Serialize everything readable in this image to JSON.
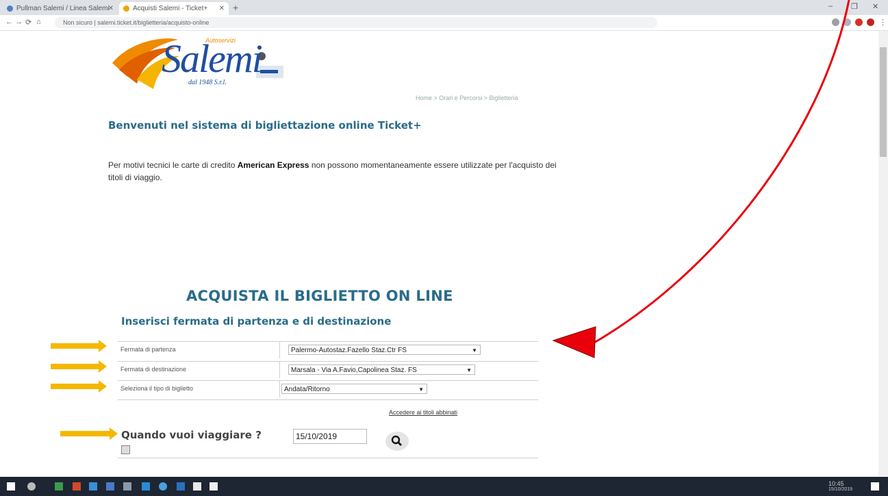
{
  "browser": {
    "tabs": [
      {
        "label": "Pullman Salemi / Linea Salemi",
        "active": false
      },
      {
        "label": "Acquisti Salemi - Ticket+",
        "active": true
      }
    ],
    "new_tab_glyph": "+",
    "window_controls": [
      "–",
      "❐",
      "✕"
    ],
    "nav": {
      "back": "←",
      "forward": "→",
      "reload": "⟳",
      "home": "⌂"
    },
    "address": "Non sicuro | salemi.ticket.it/biglietteria/acquisto-online"
  },
  "brand": {
    "logo_text": "Salemi",
    "logo_tagline": "Autoservizi",
    "logo_small": "dal 1948  S.r.l."
  },
  "breadcrumb": "Home > Orari e Percorsi > Biglietteria",
  "welcome_title": "Benvenuti nel sistema di bigliettazione online Ticket+",
  "notice": {
    "before": "Per motivi tecnici le carte di credito ",
    "bold": "American Express",
    "after": " non possono momentaneamente essere utilizzate per l'acquisto dei titoli di viaggio."
  },
  "purchase": {
    "title": "ACQUISTA IL BIGLIETTO ON LINE",
    "subtitle": "Inserisci fermata di partenza e di destinazione",
    "fields": [
      {
        "label": "Fermata di partenza",
        "value": "Palermo-Autostaz.Fazello Staz.Ctr FS"
      },
      {
        "label": "Fermata di destinazione",
        "value": "Marsala - Via A.Favio,Capolinea Staz. FS"
      },
      {
        "label": "Seleziona il tipo di biglietto",
        "value": "Andata/Ritorno"
      }
    ],
    "link": "Accedere ai titoli abbinati",
    "when_label": "Quando vuoi viaggiare ?",
    "date_value": "15/10/2019"
  },
  "colors": {
    "accent": "#2a6c8a",
    "arrow_yellow": "#f5b800",
    "arrow_red": "#e8000b",
    "logo_blue": "#1e4fa0",
    "logo_orange": "#f08a00"
  },
  "icons": {
    "search": "search-icon",
    "calendar": "calendar-icon"
  },
  "taskbar": {
    "clock": "10:45",
    "date": "15/10/2019"
  }
}
